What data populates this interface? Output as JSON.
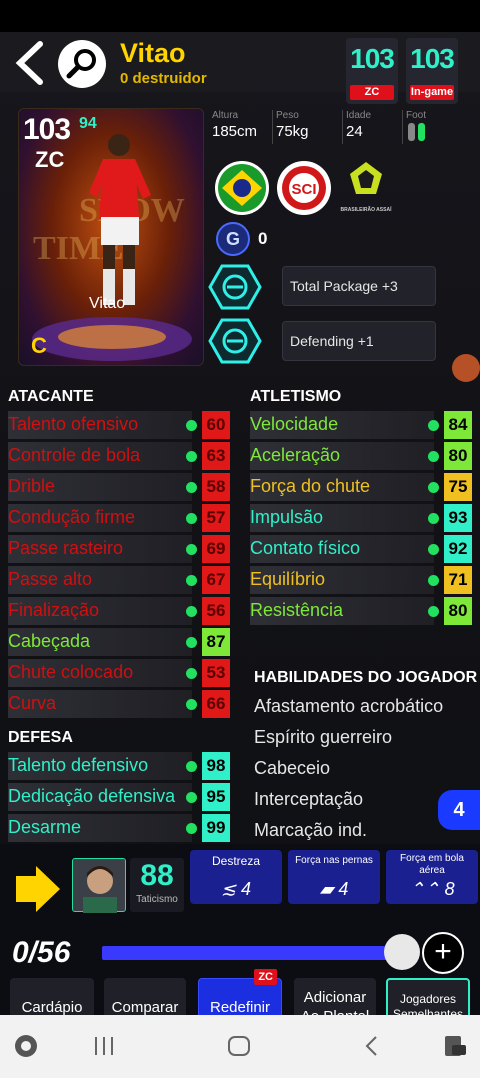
{
  "header": {
    "name": "Vitao",
    "nickname": "0 destruidor",
    "rating_zc": "103",
    "tag_zc": "ZC",
    "rating_ingame": "103",
    "tag_ingame": "In-game"
  },
  "card": {
    "rating": "103",
    "rating_sup": "94",
    "position": "ZC",
    "name": "Vitao",
    "grade": "C"
  },
  "physical": {
    "height_label": "Altura",
    "height": "185cm",
    "weight_label": "Peso",
    "weight": "75kg",
    "age_label": "Idade",
    "age": "24",
    "foot_label": "Foot"
  },
  "league_label": "BRASILEIRÃO ASSAÍ",
  "g_count": "0",
  "boosts": [
    "Total Package +3",
    "Defending +1"
  ],
  "atacante": {
    "title": "ATACANTE",
    "stats": [
      {
        "name": "Talento ofensivo",
        "value": "60",
        "color": "#d01010",
        "bg": "#e01818"
      },
      {
        "name": "Controle de bola",
        "value": "63",
        "color": "#d01010",
        "bg": "#e01818"
      },
      {
        "name": "Drible",
        "value": "58",
        "color": "#d01010",
        "bg": "#e01818"
      },
      {
        "name": "Condução firme",
        "value": "57",
        "color": "#d01010",
        "bg": "#e01818"
      },
      {
        "name": "Passe rasteiro",
        "value": "69",
        "color": "#d01010",
        "bg": "#e01818"
      },
      {
        "name": "Passe alto",
        "value": "67",
        "color": "#d01010",
        "bg": "#e01818"
      },
      {
        "name": "Finalização",
        "value": "56",
        "color": "#d01010",
        "bg": "#e01818"
      },
      {
        "name": "Cabeçada",
        "value": "87",
        "color": "#7ee838",
        "bg": "#7ee838"
      },
      {
        "name": "Chute colocado",
        "value": "53",
        "color": "#d01010",
        "bg": "#e01818"
      },
      {
        "name": "Curva",
        "value": "66",
        "color": "#d01010",
        "bg": "#e01818"
      }
    ]
  },
  "defesa": {
    "title": "DEFESA",
    "stats": [
      {
        "name": "Talento defensivo",
        "value": "98",
        "color": "#2ff0c8",
        "bg": "#2ff0c8"
      },
      {
        "name": "Dedicação defensiva",
        "value": "95",
        "color": "#2ff0c8",
        "bg": "#2ff0c8"
      },
      {
        "name": "Desarme",
        "value": "99",
        "color": "#2ff0c8",
        "bg": "#2ff0c8"
      }
    ]
  },
  "atletismo": {
    "title": "ATLETISMO",
    "stats": [
      {
        "name": "Velocidade",
        "value": "84",
        "color": "#7ee838",
        "bg": "#7ee838"
      },
      {
        "name": "Aceleração",
        "value": "80",
        "color": "#7ee838",
        "bg": "#7ee838"
      },
      {
        "name": "Força do chute",
        "value": "75",
        "color": "#f0c020",
        "bg": "#f0c020"
      },
      {
        "name": "Impulsão",
        "value": "93",
        "color": "#2ff0c8",
        "bg": "#2ff0c8"
      },
      {
        "name": "Contato físico",
        "value": "92",
        "color": "#2ff0c8",
        "bg": "#2ff0c8"
      },
      {
        "name": "Equilíbrio",
        "value": "71",
        "color": "#f0c020",
        "bg": "#f0c020"
      },
      {
        "name": "Resistência",
        "value": "80",
        "color": "#7ee838",
        "bg": "#7ee838"
      }
    ]
  },
  "skills": {
    "title": "HABILIDADES DO JOGADOR",
    "items": [
      "Afastamento acrobático",
      "Espírito guerreiro",
      "Cabeceio",
      "Interceptação",
      "Marcação ind."
    ],
    "count": "4"
  },
  "bottom": {
    "taticismo_value": "88",
    "taticismo_label": "Taticismo",
    "destreza_label": "Destreza",
    "destreza_value": "4",
    "forca_pernas_label": "Força nas pernas",
    "forca_pernas_value": "4",
    "forca_bola_label": "Força em bola aérea",
    "forca_bola_value": "8",
    "progress_text": "0/56",
    "progress_fraction": 0.96,
    "buttons": {
      "menu": "Cardápio",
      "compare": "Comparar",
      "reset": "Redefinir",
      "reset_tag": "ZC",
      "add": "Adicionar Ao Plantel",
      "similar": "Jogadores Semelhantes"
    }
  }
}
